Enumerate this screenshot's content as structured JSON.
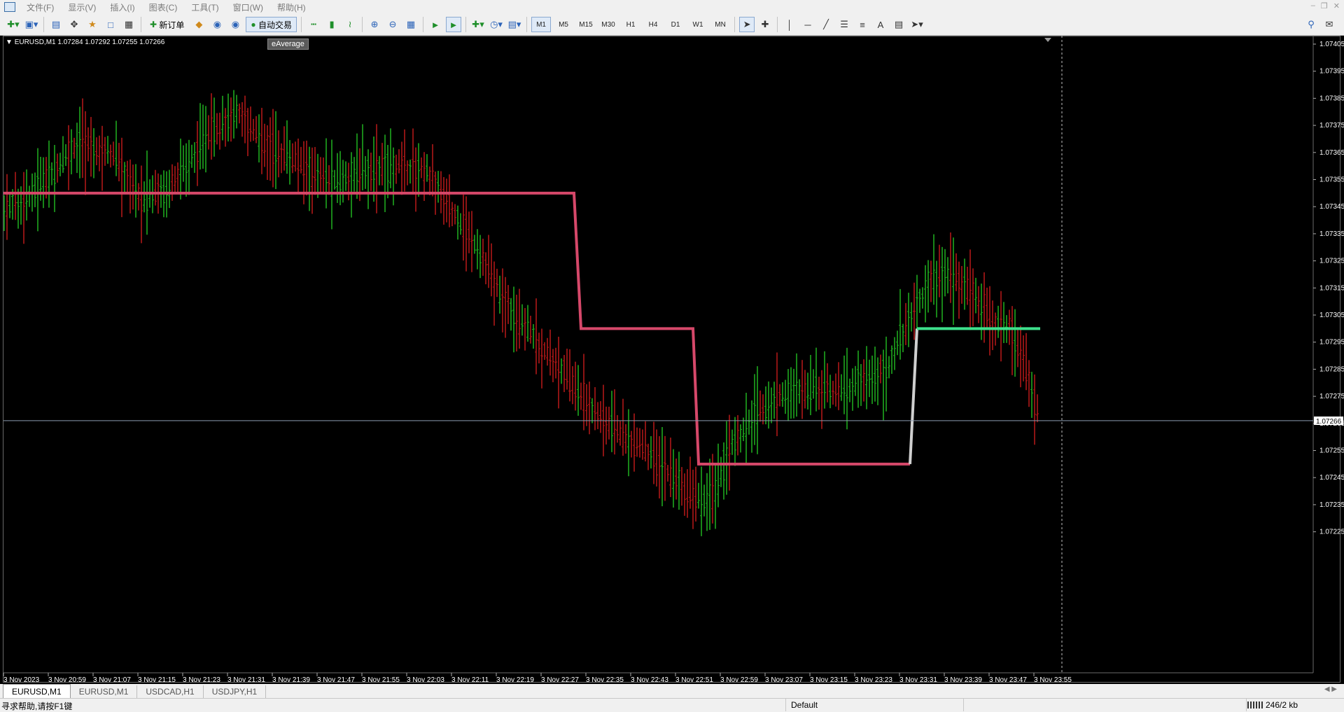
{
  "menu": [
    "文件(F)",
    "显示(V)",
    "插入(I)",
    "图表(C)",
    "工具(T)",
    "窗口(W)",
    "帮助(H)"
  ],
  "toolbar": {
    "new_order_label": "新订单",
    "auto_trading_label": "自动交易",
    "timeframes": [
      "M1",
      "M5",
      "M15",
      "M30",
      "H1",
      "H4",
      "D1",
      "W1",
      "MN"
    ],
    "active_timeframe": "M1"
  },
  "chart": {
    "symbol_info": "EURUSD,M1  1.07284 1.07292 1.07255 1.07266",
    "tooltip": "eAverage",
    "current_price_label": "1.07266",
    "background_color": "#000000",
    "bull_color": "#1fa81f",
    "bear_color": "#b01818",
    "ma_down_color": "#d6486a",
    "ma_up_color": "#3ee08c",
    "price_line_color": "#8a9bb0",
    "price_axis": [
      "1.07405",
      "1.07395",
      "1.07385",
      "1.07375",
      "1.07365",
      "1.07355",
      "1.07345",
      "1.07335",
      "1.07325",
      "1.07315",
      "1.07305",
      "1.07295",
      "1.07285",
      "1.07275",
      "1.07265",
      "1.07255",
      "1.07245",
      "1.07235",
      "1.07225"
    ],
    "time_axis": [
      "3 Nov 2023",
      "3 Nov 20:59",
      "3 Nov 21:07",
      "3 Nov 21:15",
      "3 Nov 21:23",
      "3 Nov 21:31",
      "3 Nov 21:39",
      "3 Nov 21:47",
      "3 Nov 21:55",
      "3 Nov 22:03",
      "3 Nov 22:11",
      "3 Nov 22:19",
      "3 Nov 22:27",
      "3 Nov 22:35",
      "3 Nov 22:43",
      "3 Nov 22:51",
      "3 Nov 22:59",
      "3 Nov 23:07",
      "3 Nov 23:15",
      "3 Nov 23:23",
      "3 Nov 23:31",
      "3 Nov 23:39",
      "3 Nov 23:47",
      "3 Nov 23:55"
    ]
  },
  "tabs": [
    "EURUSD,M1",
    "EURUSD,M1",
    "USDCAD,H1",
    "USDJPY,H1"
  ],
  "active_tab_index": 0,
  "status": {
    "help_text": "寻求帮助,请按F1键",
    "profile": "Default",
    "traffic": "246/2 kb"
  }
}
